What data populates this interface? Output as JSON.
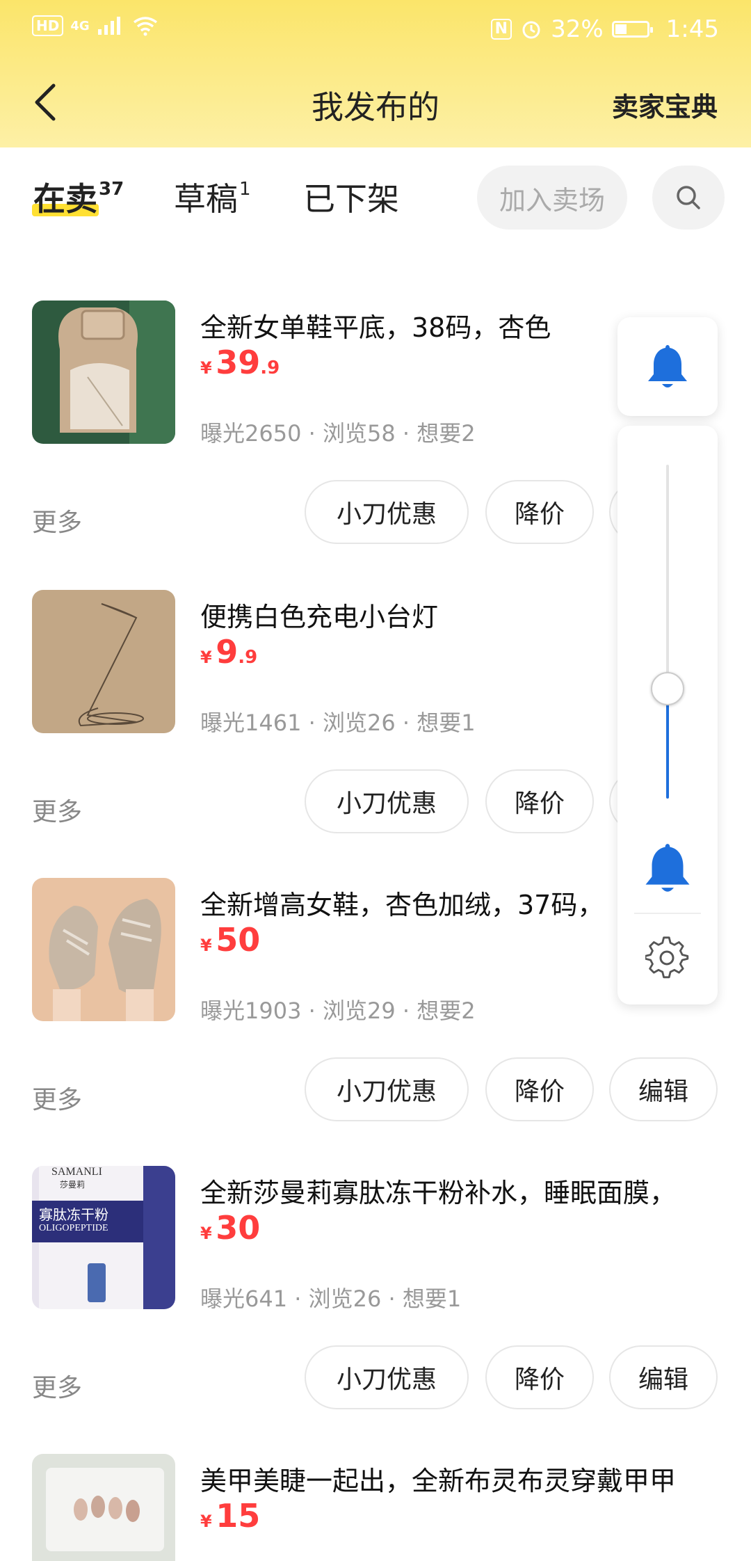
{
  "status_bar": {
    "left_badge": "HD",
    "network": "4G",
    "nfc": "N",
    "battery_percent": "32%",
    "time": "1:45"
  },
  "header": {
    "title": "我发布的",
    "right_link": "卖家宝典"
  },
  "tabs": [
    {
      "label": "在卖",
      "count": "37",
      "active": true
    },
    {
      "label": "草稿",
      "count": "1",
      "active": false
    },
    {
      "label": "已下架",
      "count": "",
      "active": false
    }
  ],
  "join_market_button": "加入卖场",
  "action_labels": {
    "more": "更多",
    "discount": "小刀优惠",
    "price_cut": "降价",
    "edit": "编辑"
  },
  "items": [
    {
      "title": "全新女单鞋平底，38码，杏色",
      "price_currency": "¥",
      "price_int": "39",
      "price_dec": ".9",
      "stats": "曝光2650 · 浏览58 · 想要2"
    },
    {
      "title": "便携白色充电小台灯",
      "price_currency": "¥",
      "price_int": "9",
      "price_dec": ".9",
      "stats": "曝光1461 · 浏览26 · 想要1"
    },
    {
      "title": "全新增高女鞋，杏色加绒，37码，",
      "price_currency": "¥",
      "price_int": "50",
      "price_dec": "",
      "stats": "曝光1903 · 浏览29 · 想要2"
    },
    {
      "title": "全新莎曼莉寡肽冻干粉补水，睡眠面膜，",
      "price_currency": "¥",
      "price_int": "30",
      "price_dec": "",
      "stats": "曝光641 · 浏览26 · 想要1"
    },
    {
      "title": "美甲美睫一起出，全新布灵布灵穿戴甲甲",
      "price_currency": "¥",
      "price_int": "15",
      "price_dec": "",
      "stats": ""
    }
  ],
  "thumb4_labels": {
    "brand": "SAMANLI",
    "cn": "莎曼莉",
    "product": "寡肽冻干粉",
    "en": "OLIGOPEPTIDE"
  },
  "volume": {
    "level": 0.33,
    "accent_color": "#1e6fdc"
  },
  "colors": {
    "header_yellow": "#fbe56a",
    "price_red": "#ff3d3d",
    "tab_highlight": "#ffe033"
  }
}
